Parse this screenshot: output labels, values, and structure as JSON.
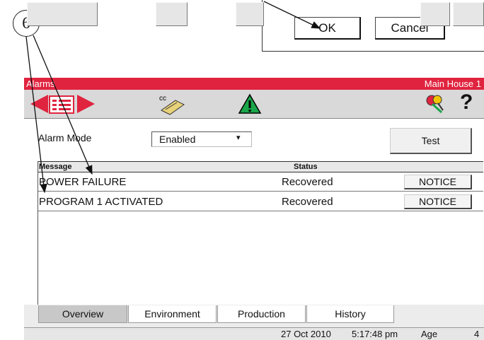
{
  "callout": {
    "number": "6"
  },
  "dialog": {
    "ok_label": "OK",
    "cancel_label": "Cancel"
  },
  "window": {
    "title": "Alarms",
    "location": "Main House 1"
  },
  "toolbar": {
    "cc_icon_text": "cc",
    "help_glyph": "?"
  },
  "alarm_mode": {
    "label": "Alarm Mode",
    "value": "Enabled"
  },
  "test_button": "Test",
  "table": {
    "headers": {
      "message": "Message",
      "status": "Status"
    },
    "rows": [
      {
        "message": "POWER FAILURE",
        "status": "Recovered",
        "action": "NOTICE"
      },
      {
        "message": "PROGRAM 1 ACTIVATED",
        "status": "Recovered",
        "action": "NOTICE"
      }
    ]
  },
  "tabs": [
    {
      "label": "Overview",
      "active": true
    },
    {
      "label": "Environment",
      "active": false
    },
    {
      "label": "Production",
      "active": false
    },
    {
      "label": "History",
      "active": false
    }
  ],
  "statusbar": {
    "date": "27 Oct 2010",
    "time": "5:17:48 pm",
    "age_label": "Age",
    "age_value": "4"
  },
  "colors": {
    "title_bar": "#e0243f",
    "nav_arrow": "#e0243f",
    "warning": "#1aa64a"
  },
  "icons": [
    "arrow-left-icon",
    "list-icon",
    "arrow-right-icon",
    "cc-ticket-icon",
    "warning-icon",
    "keys-icon",
    "help-icon"
  ]
}
